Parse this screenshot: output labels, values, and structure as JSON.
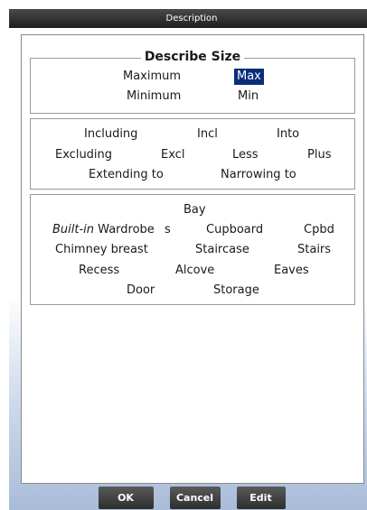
{
  "window": {
    "title": "Description"
  },
  "size_box": {
    "legend": "Describe Size",
    "maximum": "Maximum",
    "max": "Max",
    "minimum": "Minimum",
    "min": "Min"
  },
  "range_box": {
    "including": "Including",
    "incl": "Incl",
    "into": "Into",
    "excluding": "Excluding",
    "excl": "Excl",
    "less": "Less",
    "plus": "Plus",
    "extending_to": "Extending to",
    "narrowing_to": "Narrowing to"
  },
  "feature_box": {
    "bay": "Bay",
    "built_in": "Built-in",
    "wardrobe": "Wardrobe",
    "s": "s",
    "cupboard": "Cupboard",
    "cpbd": "Cpbd",
    "chimney_breast": "Chimney breast",
    "staircase": "Staircase",
    "stairs": "Stairs",
    "recess": "Recess",
    "alcove": "Alcove",
    "eaves": "Eaves",
    "door": "Door",
    "storage": "Storage"
  },
  "buttons": {
    "ok": "OK",
    "cancel": "Cancel",
    "edit": "Edit"
  },
  "colors": {
    "selection": "#0a2c7a",
    "titlebar": "#2a2a2a",
    "button": "#3a3a3a"
  }
}
